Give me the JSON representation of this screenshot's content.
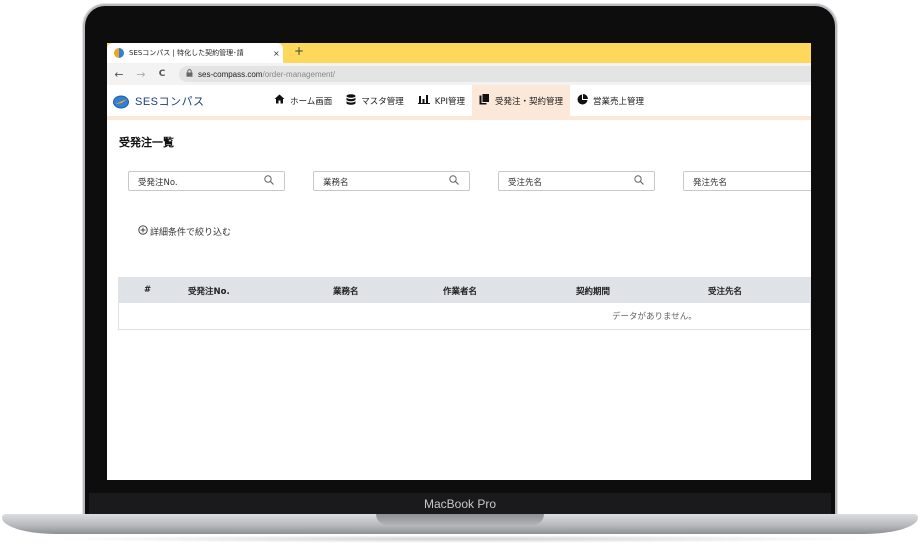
{
  "device": {
    "model": "MacBook Pro"
  },
  "browser": {
    "tab_title": "SESコンパス | 特化した契約管理･請",
    "tab_close": "×",
    "new_tab": "+",
    "back": "←",
    "forward": "→",
    "reload": "C",
    "url_host": "ses-compass.com",
    "url_path": "/order-management/"
  },
  "app": {
    "logo_text": "SESコンパス",
    "nav": [
      {
        "label": "ホーム画面",
        "icon": "home-icon"
      },
      {
        "label": "マスタ管理",
        "icon": "database-icon"
      },
      {
        "label": "KPI管理",
        "icon": "bar-chart-icon"
      },
      {
        "label": "受発注・契約管理",
        "icon": "documents-icon",
        "active": true
      },
      {
        "label": "営業売上管理",
        "icon": "pie-chart-icon"
      }
    ]
  },
  "page": {
    "title": "受発注一覧",
    "search_fields": [
      {
        "placeholder": "受発注No."
      },
      {
        "placeholder": "業務名"
      },
      {
        "placeholder": "受注先名"
      },
      {
        "placeholder": "発注先名"
      }
    ],
    "filter_link": "詳細条件で絞り込む",
    "table": {
      "columns": [
        "#",
        "受発注No.",
        "業務名",
        "作業者名",
        "契約期間",
        "受注先名"
      ],
      "empty_message": "データがありません。"
    }
  },
  "colors": {
    "tab_bar": "#fdd85a",
    "nav_active": "#fbe8d8",
    "table_header": "#dfe3e8"
  }
}
